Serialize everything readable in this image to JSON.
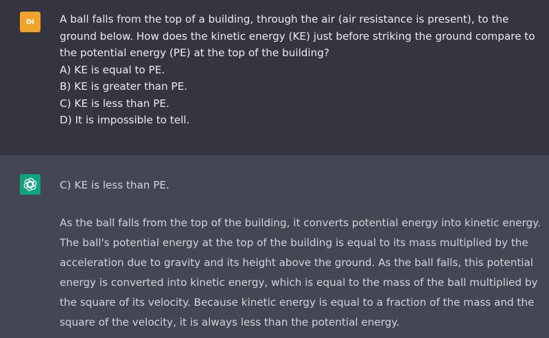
{
  "user_message": {
    "avatar_initials": "DI",
    "question": "A ball falls from the top of a building, through the air (air resistance is present), to the ground below. How does the kinetic energy (KE) just before striking the ground compare to the potential energy (PE) at the top of the building?",
    "options": [
      "A) KE is equal to PE.",
      "B) KE is greater than PE.",
      "C) KE is less than PE.",
      "D) It is impossible to tell."
    ]
  },
  "assistant_message": {
    "avatar_icon": "openai-logo-icon",
    "answer": "C) KE is less than PE.",
    "explanation": "As the ball falls from the top of the building, it converts potential energy into kinetic energy. The ball's potential energy at the top of the building is equal to its mass multiplied by the acceleration due to gravity and its height above the ground. As the ball falls, this potential energy is converted into kinetic energy, which is equal to the mass of the ball multiplied by the square of its velocity. Because kinetic energy is equal to a fraction of the mass and the square of the velocity, it is always less than the potential energy."
  },
  "colors": {
    "user_bg": "#343541",
    "assistant_bg": "#444654",
    "user_avatar": "#f0a52a",
    "bot_avatar": "#10a37f"
  }
}
